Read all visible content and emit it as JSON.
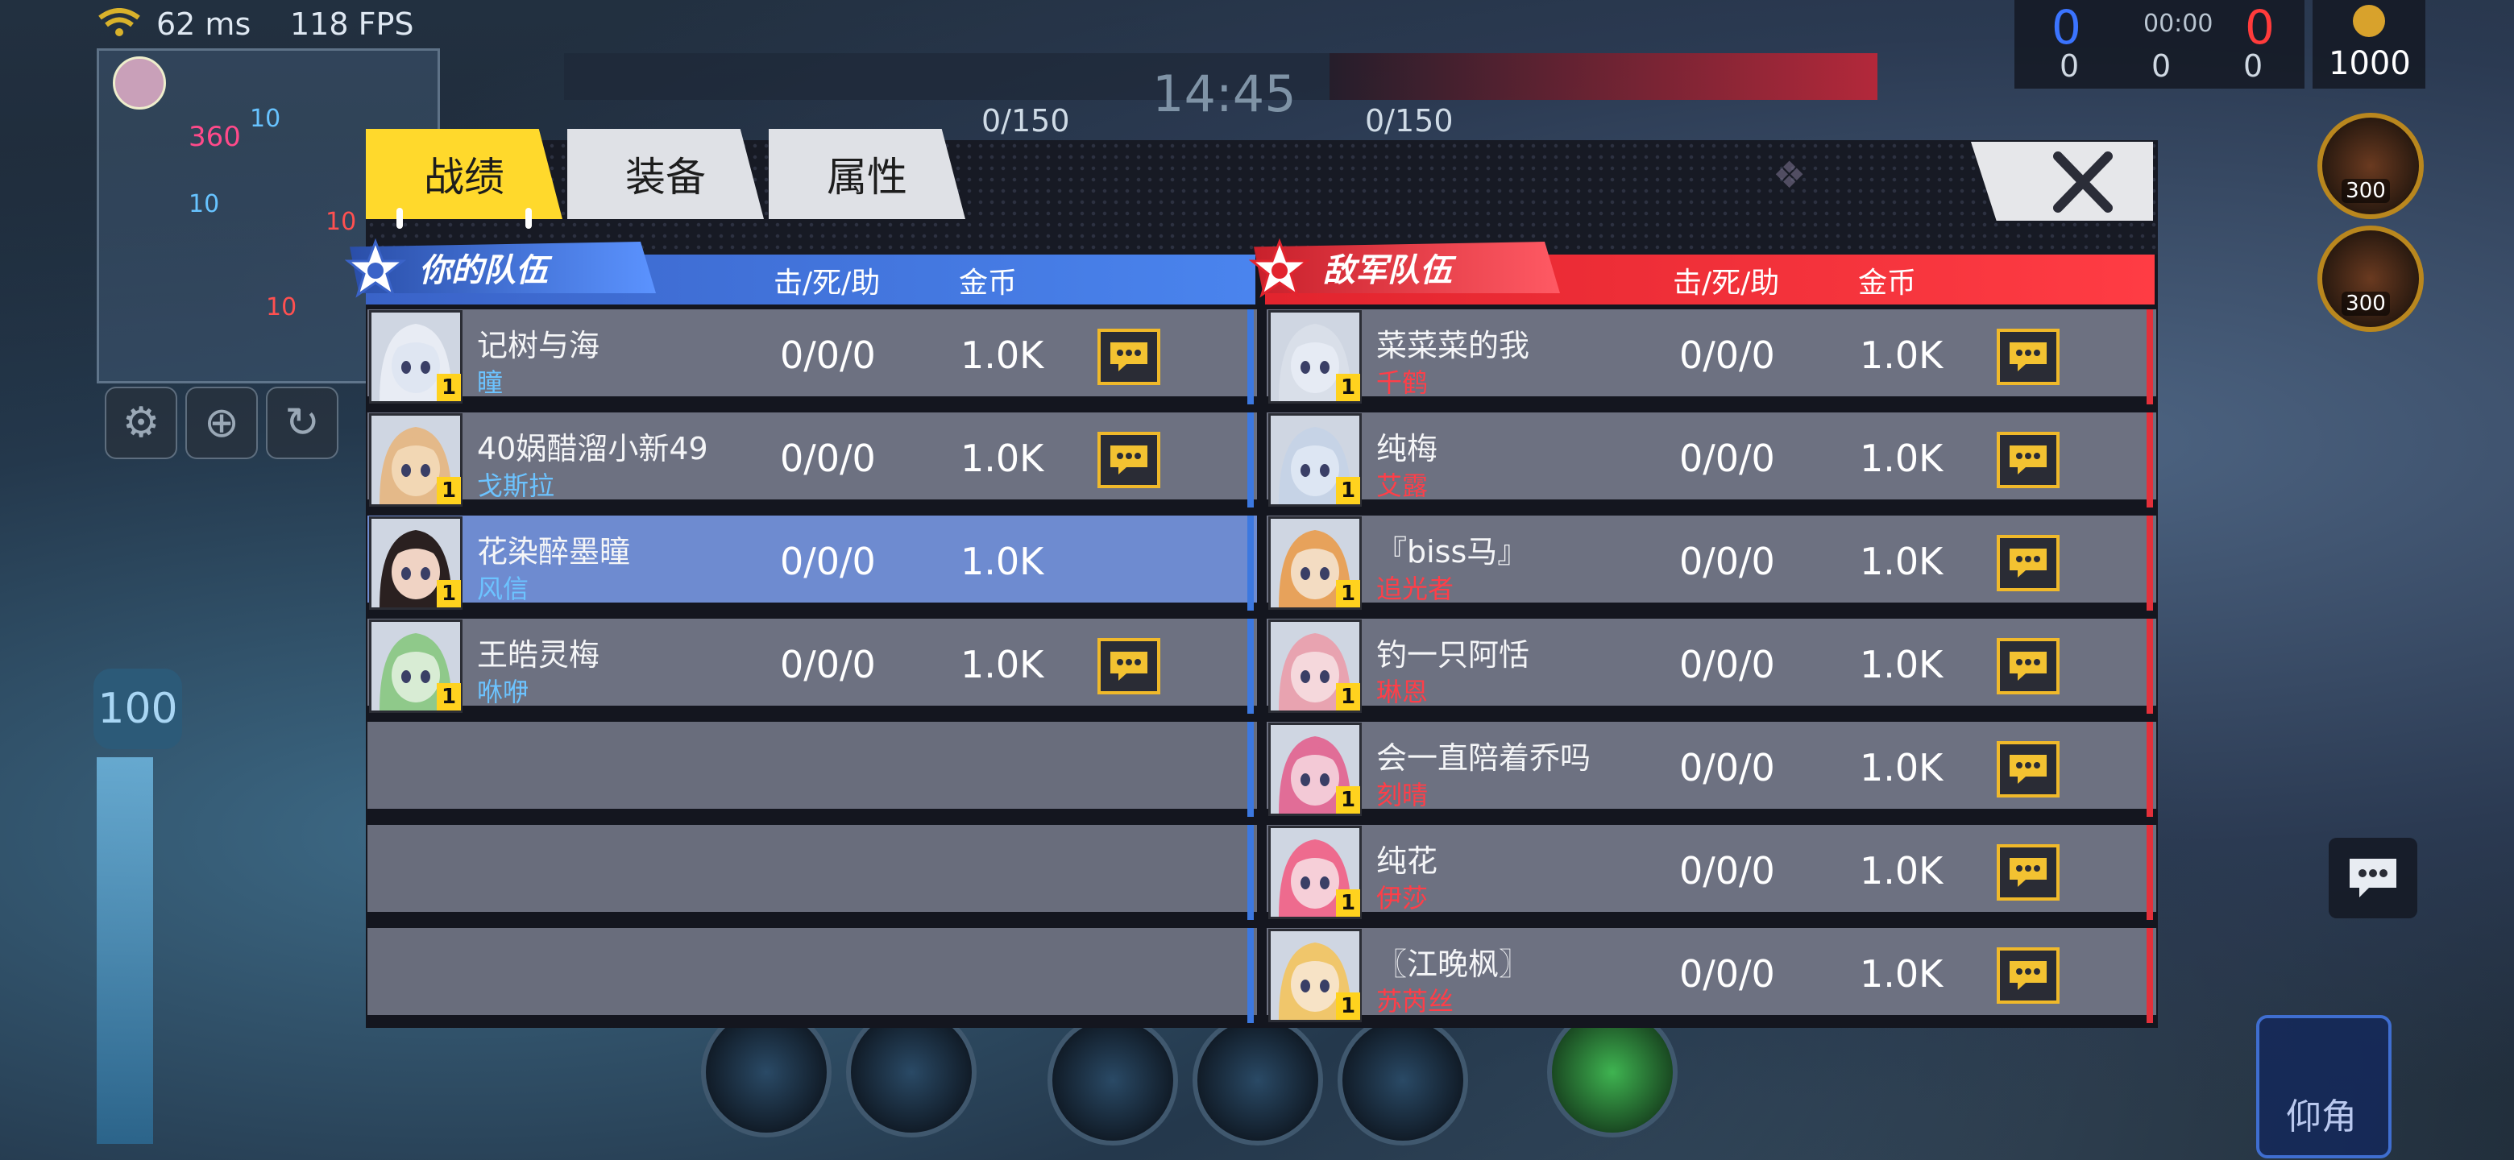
{
  "hud": {
    "ping": "62 ms",
    "fps": "118 FPS",
    "timer": "14:45",
    "ally_score": "0/150",
    "enemy_score": "0/150",
    "kills_blue": "0",
    "kills_red": "0",
    "kills_time": "00:00",
    "stat_a": "0",
    "stat_b": "0",
    "stat_c": "0",
    "gold": "1000",
    "item1_price": "300",
    "item2_price": "300",
    "hp_badge": "100",
    "look_button": "仰角",
    "minimap_labels": [
      "360",
      "10",
      "10",
      "10",
      "10"
    ]
  },
  "tabs": [
    {
      "label": "战绩",
      "active": true
    },
    {
      "label": "装备",
      "active": false
    },
    {
      "label": "属性",
      "active": false
    }
  ],
  "ally_team": {
    "title": "你的队伍",
    "col_kda": "击/死/助",
    "col_gold": "金币",
    "players": [
      {
        "name": "记树与海",
        "hero": "瞳",
        "level": "1",
        "kda": "0/0/0",
        "gold": "1.0K",
        "chat": true,
        "portrait": "#dfe6f2",
        "hair": "#e8ecf4"
      },
      {
        "name": "40娲醋溜小新49",
        "hero": "戈斯拉",
        "level": "1",
        "kda": "0/0/0",
        "gold": "1.0K",
        "chat": true,
        "portrait": "#f2d7b4",
        "hair": "#e4b989"
      },
      {
        "name": "花染醉墨瞳",
        "hero": "风信",
        "level": "1",
        "kda": "0/0/0",
        "gold": "1.0K",
        "chat": false,
        "portrait": "#f0d3c4",
        "hair": "#2a2020"
      },
      {
        "name": "王皓灵梅",
        "hero": "咻咿",
        "level": "1",
        "kda": "0/0/0",
        "gold": "1.0K",
        "chat": true,
        "portrait": "#d8ecd4",
        "hair": "#8fc98a"
      }
    ]
  },
  "enemy_team": {
    "title": "敌军队伍",
    "col_kda": "击/死/助",
    "col_gold": "金币",
    "players": [
      {
        "name": "菜菜菜的我",
        "hero": "千鹤",
        "level": "1",
        "kda": "0/0/0",
        "gold": "1.0K",
        "chat": true,
        "portrait": "#e6ebf4",
        "hair": "#d9dfe9"
      },
      {
        "name": "纯梅",
        "hero": "艾露",
        "level": "1",
        "kda": "0/0/0",
        "gold": "1.0K",
        "chat": true,
        "portrait": "#dde6f3",
        "hair": "#c6d3e6"
      },
      {
        "name": "『biss马』",
        "hero": "追光者",
        "level": "1",
        "kda": "0/0/0",
        "gold": "1.0K",
        "chat": true,
        "portrait": "#f3dcc2",
        "hair": "#e7a25b"
      },
      {
        "name": "钓一只阿恬",
        "hero": "琳恩",
        "level": "1",
        "kda": "0/0/0",
        "gold": "1.0K",
        "chat": true,
        "portrait": "#f5d8dc",
        "hair": "#e8a3b0"
      },
      {
        "name": "会一直陪着乔吗",
        "hero": "刻晴",
        "level": "1",
        "kda": "0/0/0",
        "gold": "1.0K",
        "chat": true,
        "portrait": "#f3c9d6",
        "hair": "#e16d97"
      },
      {
        "name": "纯花",
        "hero": "伊莎",
        "level": "1",
        "kda": "0/0/0",
        "gold": "1.0K",
        "chat": true,
        "portrait": "#f6cfd8",
        "hair": "#ee6b8e"
      },
      {
        "name": "〖江晚枫〗",
        "hero": "苏芮丝",
        "level": "1",
        "kda": "0/0/0",
        "gold": "1.0K",
        "chat": true,
        "portrait": "#f7e3c6",
        "hair": "#f0c66b"
      }
    ]
  },
  "colors": {
    "tab_active": "#ffd92c",
    "ally_accent": "#4a84ee",
    "enemy_accent": "#ff3c44",
    "chat_border": "#f0b92a",
    "level_badge": "#ffd21e"
  }
}
